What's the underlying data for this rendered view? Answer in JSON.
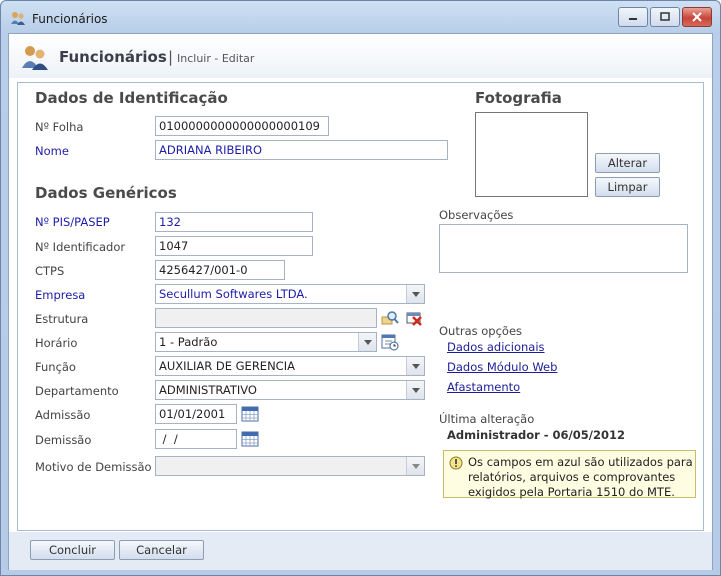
{
  "window": {
    "title": "Funcionários"
  },
  "header": {
    "title": "Funcionários",
    "separator": "|",
    "subtitle": "Incluir - Editar"
  },
  "identificacao": {
    "title": "Dados de Identificação",
    "folha_label": "Nº Folha",
    "folha_value": "0100000000000000000109",
    "nome_label": "Nome",
    "nome_value": "ADRIANA RIBEIRO"
  },
  "foto": {
    "title": "Fotografia",
    "alterar": "Alterar",
    "limpar": "Limpar"
  },
  "observacoes": {
    "label": "Observações"
  },
  "genericos": {
    "title": "Dados Genéricos",
    "pis_label": "Nº PIS/PASEP",
    "pis_value": "132",
    "ident_label": "Nº Identificador",
    "ident_value": "1047",
    "ctps_label": "CTPS",
    "ctps_value": "4256427/001-0",
    "empresa_label": "Empresa",
    "empresa_value": "Secullum Softwares LTDA.",
    "estrutura_label": "Estrutura",
    "estrutura_value": "",
    "horario_label": "Horário",
    "horario_value": "1 - Padrão",
    "funcao_label": "Função",
    "funcao_value": "AUXILIAR DE GERENCIA",
    "departamento_label": "Departamento",
    "departamento_value": "ADMINISTRATIVO",
    "admissao_label": "Admissão",
    "admissao_value": "01/01/2001",
    "demissao_label": "Demissão",
    "demissao_value": " /  /",
    "motivo_label": "Motivo de Demissão",
    "motivo_value": ""
  },
  "outras": {
    "label": "Outras opções",
    "links": [
      "Dados adicionais",
      "Dados Módulo Web",
      "Afastamento"
    ]
  },
  "ultima": {
    "label": "Última alteração",
    "value": "Administrador - 06/05/2012"
  },
  "info": {
    "text": "Os campos em azul são utilizados para relatórios, arquivos e comprovantes exigidos pela Portaria 1510 do MTE."
  },
  "footer": {
    "concluir": "Concluir",
    "cancelar": "Cancelar"
  }
}
